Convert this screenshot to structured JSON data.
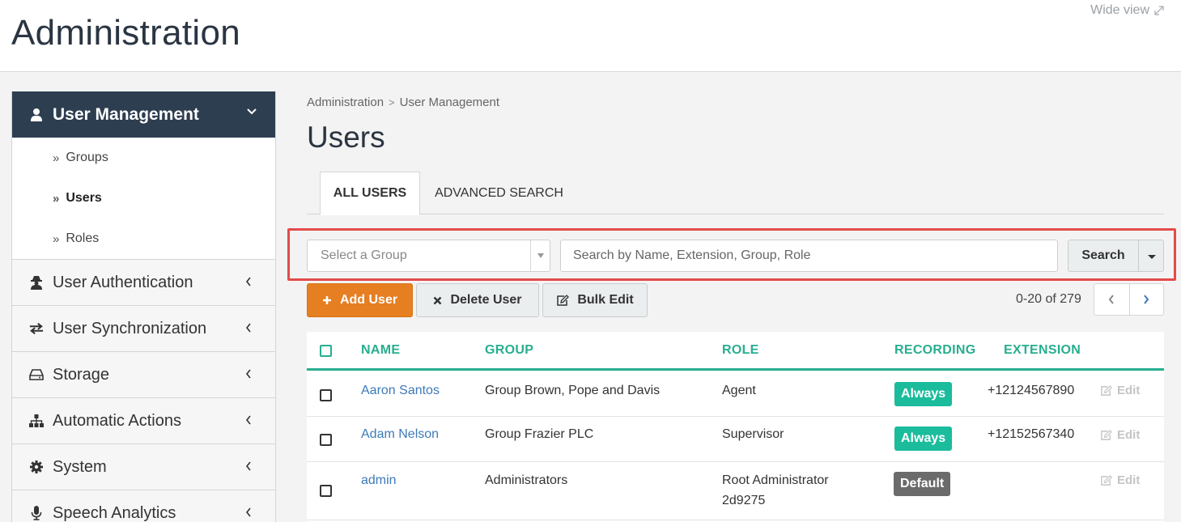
{
  "header": {
    "title": "Administration",
    "wide_view": "Wide view"
  },
  "sidebar": {
    "section": {
      "label": "User Management",
      "icon": "user-icon"
    },
    "sub_items": [
      {
        "label": "Groups",
        "active": false
      },
      {
        "label": "Users",
        "active": true
      },
      {
        "label": "Roles",
        "active": false
      }
    ],
    "items": [
      {
        "label": "User Authentication",
        "icon": "user-secret-icon"
      },
      {
        "label": "User Synchronization",
        "icon": "exchange-icon"
      },
      {
        "label": "Storage",
        "icon": "hdd-icon"
      },
      {
        "label": "Automatic Actions",
        "icon": "sitemap-icon"
      },
      {
        "label": "System",
        "icon": "gear-icon"
      },
      {
        "label": "Speech Analytics",
        "icon": "microphone-icon"
      }
    ]
  },
  "breadcrumb": [
    "Administration",
    "User Management"
  ],
  "page_title": "Users",
  "tabs": [
    {
      "label": "ALL USERS",
      "active": true
    },
    {
      "label": "ADVANCED SEARCH",
      "active": false
    }
  ],
  "filters": {
    "group_placeholder": "Select a Group",
    "search_placeholder": "Search by Name, Extension, Group, Role",
    "search_button": "Search"
  },
  "toolbar": {
    "add_user": "Add User",
    "delete_user": "Delete User",
    "bulk_edit": "Bulk Edit"
  },
  "pagination": {
    "range": "0-20 of 279"
  },
  "table": {
    "columns": [
      "NAME",
      "GROUP",
      "ROLE",
      "RECORDING",
      "EXTENSION"
    ],
    "edit_label": "Edit",
    "rows": [
      {
        "name": "Aaron Santos",
        "group": "Group Brown, Pope and Davis",
        "role": "Agent",
        "role2": "",
        "recording": "Always",
        "recording_color": "#1abc9c",
        "extension": "+12124567890"
      },
      {
        "name": "Adam Nelson",
        "group": "Group Frazier PLC",
        "role": "Supervisor",
        "role2": "",
        "recording": "Always",
        "recording_color": "#1abc9c",
        "extension": "+12152567340"
      },
      {
        "name": "admin",
        "group": "Administrators",
        "role": "Root Administrator",
        "role2": "2d9275",
        "recording": "Default",
        "recording_color": "#6b6b6b",
        "extension": ""
      }
    ]
  },
  "colors": {
    "sidebar_header": "#2e3e51",
    "accent_green": "#27ae8f",
    "add_button": "#e67e22",
    "highlight": "#e24b4b"
  }
}
